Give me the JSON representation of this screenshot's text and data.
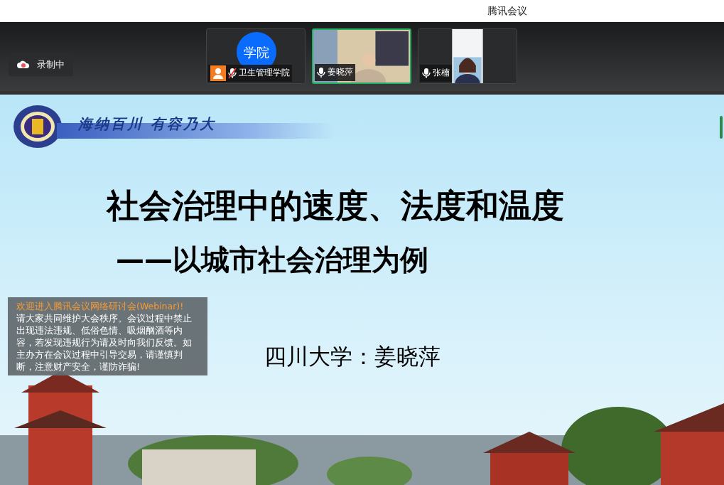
{
  "window": {
    "title": "腾讯会议"
  },
  "recording": {
    "label": "录制中"
  },
  "participants": [
    {
      "kind": "avatar",
      "avatar_text": "学院",
      "name": "卫生管理学院",
      "muted": true,
      "selected": false,
      "host": true
    },
    {
      "kind": "video",
      "name": "姜晓萍",
      "muted": false,
      "selected": true,
      "host": false
    },
    {
      "kind": "video",
      "name": "张楠",
      "muted": false,
      "selected": false,
      "host": false
    }
  ],
  "slide": {
    "motto": "海纳百川 有容乃大",
    "title": "社会治理中的速度、法度和温度",
    "subtitle": "——以城市社会治理为例",
    "presenter": "四川大学：姜晓萍"
  },
  "notice": {
    "title": "欢迎进入腾讯会议网络研讨会(Webinar)!",
    "body": "请大家共同维护大会秩序。会议过程中禁止出现违法违规、低俗色情、吸烟酗酒等内容，若发现违规行为请及时向我们反馈。如主办方在会议过程中引导交易，请谨慎判断，注意财产安全，谨防诈骗!"
  }
}
